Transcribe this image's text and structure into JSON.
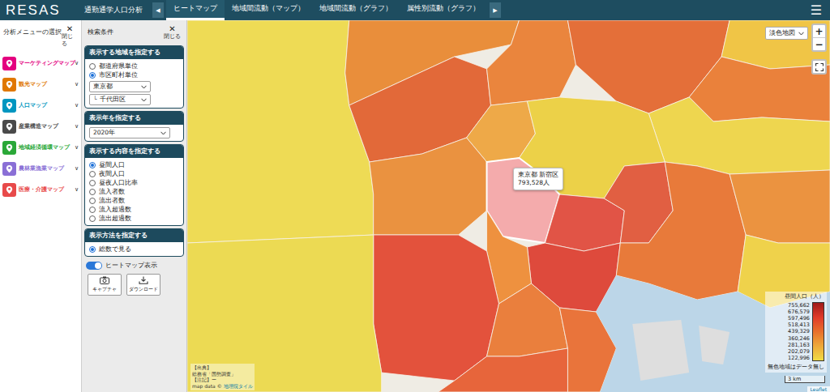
{
  "header": {
    "logo": "RESAS",
    "section": "通勤通学人口分析",
    "prev": "◀",
    "next": "▶",
    "menu": "☰",
    "tabs": [
      {
        "label": "ヒートマップ",
        "selected": true
      },
      {
        "label": "地域間流動（マップ）",
        "selected": false
      },
      {
        "label": "地域間流動（グラフ）",
        "selected": false
      },
      {
        "label": "属性別流動（グラフ）",
        "selected": false
      }
    ]
  },
  "menu_panel": {
    "title": "分析メニューの選択",
    "close_icon": "✕",
    "close_label": "閉じる",
    "items": [
      {
        "label": "マーケティングマップ",
        "color": "#e4007f",
        "expand": "∨"
      },
      {
        "label": "観光マップ",
        "color": "#e07800",
        "expand": "∨"
      },
      {
        "label": "人口マップ",
        "color": "#0096c0",
        "expand": "∨"
      },
      {
        "label": "産業構造マップ",
        "color": "#4a4a4a",
        "expand": "∨"
      },
      {
        "label": "地域経済循環マップ",
        "color": "#2aa838",
        "expand": "∨"
      },
      {
        "label": "農林業漁業マップ",
        "color": "#8a6fd6",
        "expand": "∨"
      },
      {
        "label": "医療・介護マップ",
        "color": "#e84a4a",
        "expand": "∨"
      }
    ]
  },
  "search_panel": {
    "title": "検索条件",
    "close_icon": "✕",
    "close_label": "閉じる",
    "region_section": {
      "title": "表示する地域を指定する",
      "options": [
        {
          "label": "都道府県単位",
          "selected": false
        },
        {
          "label": "市区町村単位",
          "selected": true
        }
      ],
      "prefecture": "東京都",
      "city_prefix": "└",
      "city": "千代田区"
    },
    "year_section": {
      "title": "表示年を指定する",
      "value": "2020年"
    },
    "content_section": {
      "title": "表示する内容を指定する",
      "options": [
        {
          "label": "昼間人口",
          "selected": true
        },
        {
          "label": "夜間人口",
          "selected": false
        },
        {
          "label": "昼夜人口比率",
          "selected": false
        },
        {
          "label": "流入者数",
          "selected": false
        },
        {
          "label": "流出者数",
          "selected": false
        },
        {
          "label": "流入超過数",
          "selected": false
        },
        {
          "label": "流出超過数",
          "selected": false
        }
      ]
    },
    "method_section": {
      "title": "表示方法を指定する",
      "options": [
        {
          "label": "総数で見る",
          "selected": true
        }
      ]
    },
    "heatmap_toggle": {
      "label": "ヒートマップ表示",
      "on": true
    },
    "buttons": [
      {
        "label": "キャプチャ",
        "kind": "camera"
      },
      {
        "label": "ダウンロード",
        "kind": "download"
      }
    ]
  },
  "map": {
    "style_select": "淡色地図",
    "zoom_in": "+",
    "zoom_out": "−",
    "regions": [
      {
        "color": "#eed94a",
        "selected": false
      },
      {
        "color": "#e8862e",
        "selected": false
      },
      {
        "color": "#e15f2c",
        "selected": false
      },
      {
        "color": "#ea7d30",
        "selected": false
      },
      {
        "color": "#e3652c",
        "selected": false
      },
      {
        "color": "#f0c23a",
        "selected": false
      },
      {
        "color": "#e9782e",
        "selected": false
      },
      {
        "color": "#eed444",
        "selected": false
      },
      {
        "color": "#eea43c",
        "selected": false
      },
      {
        "color": "#eccf3c",
        "selected": false
      },
      {
        "color": "#ea8b34",
        "selected": false
      },
      {
        "color": "#f4a6a8",
        "selected": true
      },
      {
        "color": "#e0483a",
        "selected": false
      },
      {
        "color": "#e05436",
        "selected": false
      },
      {
        "color": "#dd3d2f",
        "selected": false
      },
      {
        "color": "#ee8a33",
        "selected": false
      },
      {
        "color": "#e2462f",
        "selected": false
      },
      {
        "color": "#ecd848",
        "selected": false
      },
      {
        "color": "#ea7630",
        "selected": false
      },
      {
        "color": "#e86a2e",
        "selected": false
      },
      {
        "color": "#e65a2e",
        "selected": false
      },
      {
        "color": "#e7712d",
        "selected": false
      },
      {
        "color": "#eb8c34",
        "selected": false
      },
      {
        "color": "#efd040",
        "selected": false
      }
    ],
    "tooltip": {
      "place": "東京都 新宿区",
      "value": "793,528人"
    },
    "legend": {
      "title": "昼間人口（人）",
      "ticks": [
        "755,662",
        "676,579",
        "597,496",
        "518,413",
        "439,329",
        "360,246",
        "281,163",
        "202,079",
        "122,996"
      ],
      "note": "無色地域はデータ無し"
    },
    "scale": "3 km",
    "attribution": {
      "source_label": "【出典】",
      "source": "総務省「国勢調査」",
      "note_label": "【注記】",
      "note": "ー",
      "map_data": "map data ©",
      "tiles": "地理院タイル"
    },
    "leaflet": "Leaflet"
  }
}
